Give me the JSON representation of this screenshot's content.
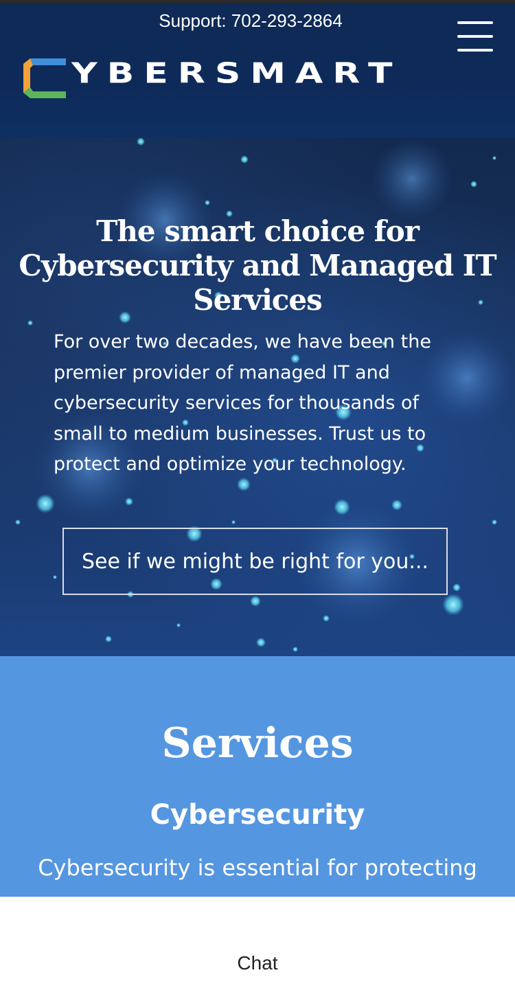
{
  "header": {
    "support_text": "Support: 702-293-2864",
    "logo_text": "YBERSMART",
    "logo_alt": "CyberSmart",
    "menu_icon": "hamburger-menu-icon",
    "background": "#0e2a59"
  },
  "hero": {
    "title": "The smart choice for Cybersecurity and Managed IT Services",
    "body": "For over two decades, we have been the premier provider of managed IT and cybersecurity services for thousands of small to medium businesses. Trust us to protect and optimize your technology.",
    "cta_label": "See if we might be right for you..."
  },
  "services": {
    "heading": "Services",
    "subheading": "Cybersecurity",
    "body": "Cybersecurity is essential for protecting",
    "background": "#5596e1"
  },
  "chat": {
    "label": "Chat"
  },
  "colors": {
    "logo_orange": "#f2a13b",
    "logo_blue": "#3f8fdc",
    "logo_green": "#5bb55a"
  }
}
